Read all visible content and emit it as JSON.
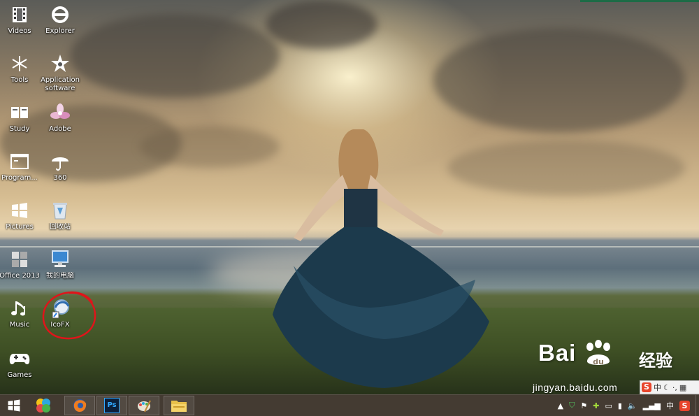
{
  "desktop": {
    "icons": [
      {
        "label": "Videos",
        "icon": "film-icon"
      },
      {
        "label": "Explorer",
        "icon": "ie-icon"
      },
      {
        "label": "Tools",
        "icon": "snowflake-icon"
      },
      {
        "label": "Application software",
        "icon": "star-icon"
      },
      {
        "label": "Study",
        "icon": "book-icon"
      },
      {
        "label": "Adobe",
        "icon": "adobe-icon"
      },
      {
        "label": "Program...",
        "icon": "window-icon"
      },
      {
        "label": "360",
        "icon": "umbrella-icon"
      },
      {
        "label": "Pictures",
        "icon": "windows-logo-icon"
      },
      {
        "label": "回收站",
        "icon": "recycle-bin-icon"
      },
      {
        "label": "Office 2013",
        "icon": "office-icon"
      },
      {
        "label": "我的电脑",
        "icon": "computer-icon"
      },
      {
        "label": "Music",
        "icon": "music-icon"
      },
      {
        "label": "IcoFX",
        "icon": "icofx-icon"
      },
      {
        "label": "Games",
        "icon": "gamepad-icon"
      }
    ]
  },
  "watermark": {
    "brand": "Bai",
    "brand2": "经验",
    "url": "jingyan.baidu.com"
  },
  "ime": {
    "logo": "S",
    "lang": "中"
  },
  "taskbar": {
    "apps": [
      "start-icon",
      "pinwheel-icon",
      "firefox-icon",
      "photoshop-icon",
      "paint-icon",
      "file-explorer-icon"
    ],
    "ps_label": "Ps",
    "tray_lang": "中",
    "sogou": "S"
  },
  "colors": {
    "taskbar": "#2a2016",
    "highlight_circle": "#e0141a"
  }
}
